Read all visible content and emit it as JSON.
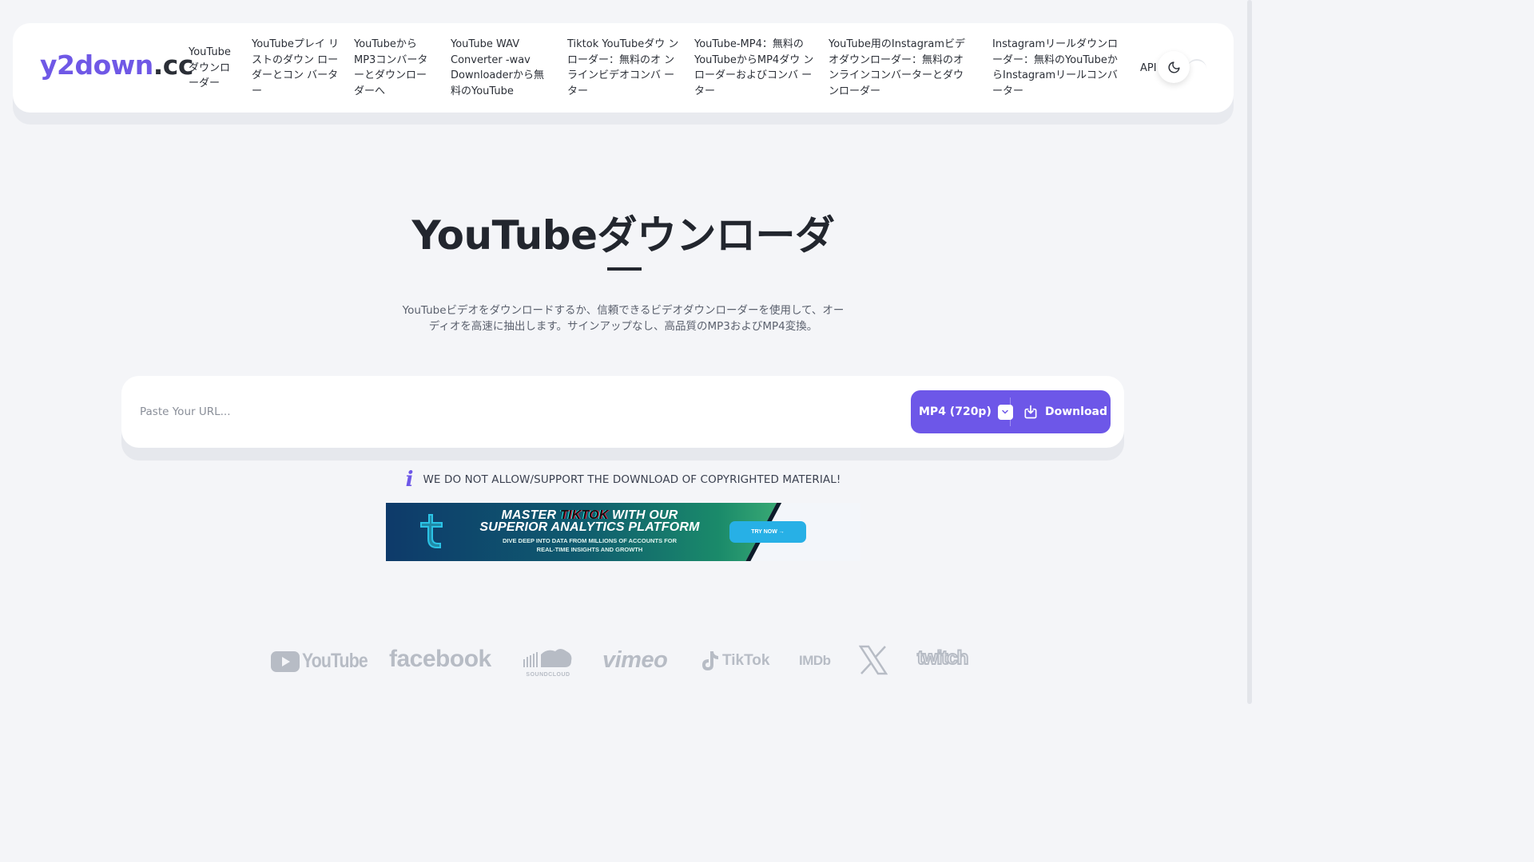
{
  "header": {
    "logo_brand": "y2down",
    "logo_tld": ".cc",
    "nav": [
      {
        "label": "YouTube ダウンロ ーダー"
      },
      {
        "label": "YouTubeプレイ リストのダウン ローダーとコン バーター"
      },
      {
        "label": "YouTubeから MP3コンバータ ーとダウンロー ダーへ"
      },
      {
        "label": "YouTube WAV Converter -wav Downloaderから無 料のYouTube"
      },
      {
        "label": "Tiktok YouTubeダウ ンローダー：無料のオ ンラインビデオコンバ ーター"
      },
      {
        "label": "YouTube-MP4：無料の YouTubeからMP4ダウ ンローダーおよびコンバ ーター"
      },
      {
        "label": "YouTube用のInstagramビデ オダウンローダー：無料のオ ンラインコンバーターとダウ ンローダー"
      },
      {
        "label": "Instagramリールダウンロ ーダー：無料のYouTubeか らInstagramリールコンバ ーター"
      },
      {
        "label": "API"
      }
    ],
    "theme_icon": "moon-icon"
  },
  "hero": {
    "title": "YouTubeダウンローダ",
    "subtitle": "YouTubeビデオをダウンロードするか、信頼できるビデオダウンローダーを使用して、オーディオを高速に抽出します。サインアップなし、高品質のMP3およびMP4変換。"
  },
  "form": {
    "url_placeholder": "Paste Your URL...",
    "url_value": "",
    "format_selected": "MP4 (720p)",
    "download_label": "Download",
    "accent": "#6d57e8"
  },
  "notice": {
    "icon": "info-icon",
    "text": "WE DO NOT ALLOW/SUPPORT THE DOWNLOAD OF COPYRIGHTED MATERIAL!"
  },
  "ad": {
    "headline_pre": "MASTER ",
    "headline_brand": "TIKTOK",
    "headline_post": " WITH OUR",
    "headline_2": "SUPERIOR ANALYTICS PLATFORM",
    "sub_1": "DIVE DEEP INTO DATA FROM MILLIONS OF ACCOUNTS FOR",
    "sub_2": "REAL-TIME INSIGHTS AND GROWTH",
    "cta": "TRY NOW →"
  },
  "platforms": {
    "youtube": "YouTube",
    "facebook": "facebook",
    "soundcloud": "SOUNDCLOUD",
    "vimeo": "vimeo",
    "tiktok": "TikTok",
    "imdb": "IMDb",
    "x": "X",
    "twitch": "twitch"
  }
}
